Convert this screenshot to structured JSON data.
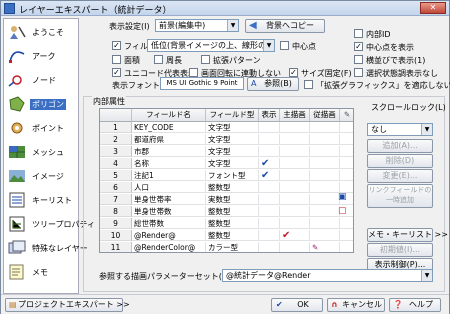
{
  "window": {
    "title": "レイヤーエキスパート（統計データ）"
  },
  "sidebar": {
    "items": [
      {
        "label": "ようこそ"
      },
      {
        "label": "アーク"
      },
      {
        "label": "ノード"
      },
      {
        "label": "ポリゴン"
      },
      {
        "label": "ポイント"
      },
      {
        "label": "メッシュ"
      },
      {
        "label": "イメージ"
      },
      {
        "label": "キーリスト"
      },
      {
        "label": "ツリープロパティ"
      },
      {
        "label": "特殊なレイヤー"
      },
      {
        "label": "メモ"
      }
    ]
  },
  "display_settings": {
    "label": "表示設定(I)",
    "preset_value": "前景(編集中)",
    "bg_copy_button": "背景へコピー",
    "fill_label": "フィル",
    "fill_value": "低位(背景イメージの上、線形の下)",
    "center_point_label": "中心点",
    "area_label": "面積",
    "perimeter_label": "周長",
    "expand_pattern_label": "拡張パターン",
    "unicode_label": "ユニコード代表表示",
    "no_screen_rotate_label": "画面回転に連動しない",
    "size_fixed_label": "サイズ固定(F)",
    "display_font_label": "表示フォント(A)",
    "font_value": "MS UI Gothic 9 Point",
    "ref_button": "参照(B)",
    "extended_graphics_label": "「拡張グラフィックス」を適応しない"
  },
  "right_options": {
    "inner_id": "内部ID",
    "center_display": "中心点を表示",
    "horizontal_text": "横並びで表示(1)",
    "selection_color": "選択状態調表示なし"
  },
  "attributes": {
    "group_label": "内部属性",
    "headers": [
      "",
      "フィールド名",
      "フィールド型",
      "表示",
      "主描画",
      "従描画"
    ],
    "rows": [
      {
        "n": "1",
        "name": "KEY_CODE",
        "type": "文字型",
        "show": false,
        "main": false,
        "sub": false
      },
      {
        "n": "2",
        "name": "都道府県",
        "type": "文字型",
        "show": false,
        "main": false,
        "sub": false
      },
      {
        "n": "3",
        "name": "市郡",
        "type": "文字型",
        "show": false,
        "main": false,
        "sub": false
      },
      {
        "n": "4",
        "name": "名称",
        "type": "文字型",
        "show": true,
        "main": false,
        "sub": false
      },
      {
        "n": "5",
        "name": "注記1",
        "type": "フォント型",
        "show": true,
        "main": false,
        "sub": false
      },
      {
        "n": "6",
        "name": "人口",
        "type": "整数型",
        "show": false,
        "main": false,
        "sub": false
      },
      {
        "n": "7",
        "name": "単身世帯率",
        "type": "実数型",
        "show": false,
        "main": false,
        "sub": false
      },
      {
        "n": "8",
        "name": "単身世帯数",
        "type": "整数型",
        "show": false,
        "main": false,
        "sub": false
      },
      {
        "n": "9",
        "name": "総世帯数",
        "type": "整数型",
        "show": false,
        "main": false,
        "sub": false
      },
      {
        "n": "10",
        "name": "@Render@",
        "type": "整数型",
        "show": false,
        "main": true,
        "sub": false
      },
      {
        "n": "11",
        "name": "@RenderColor@",
        "type": "カラー型",
        "show": false,
        "main": false,
        "sub": true
      }
    ],
    "scroll_lock_label": "スクロールロック(L)",
    "scroll_lock_value": "なし",
    "add_button": "追加(A)...",
    "delete_button": "削除(D)",
    "change_button": "変更(E)...",
    "link_field_button": "リンクフィールドの一時追加",
    "memo_keylist_button": "メモ・キーリスト >>",
    "init_button": "初期値(I)...",
    "display_control_button": "表示制御(P)..."
  },
  "render_param": {
    "label": "参照する描画パラメーターセット(P)",
    "value": "@統計データ@Render"
  },
  "footer": {
    "project_expert_button": "プロジェクトエキスパート >>",
    "ok_button": "OK",
    "cancel_button": "キャンセル",
    "help_button": "ヘルプ"
  },
  "colors": {
    "selection": "#3a6fc4",
    "check_blue": "#1a4aa8",
    "check_red": "#c0202a"
  }
}
